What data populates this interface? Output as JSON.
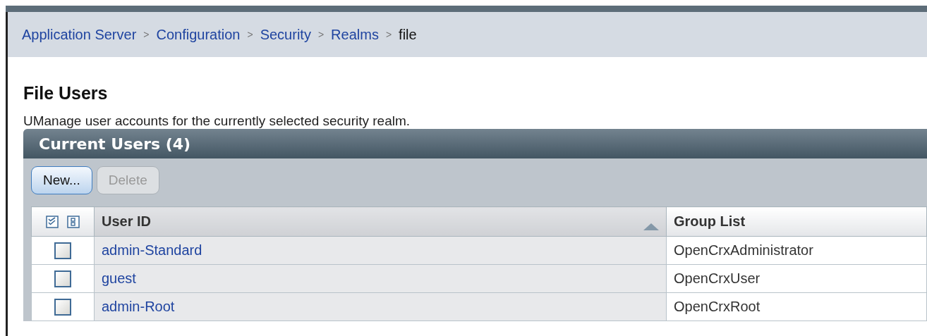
{
  "breadcrumb": [
    {
      "label": "Application Server",
      "link": true
    },
    {
      "label": "Configuration",
      "link": true
    },
    {
      "label": "Security",
      "link": true
    },
    {
      "label": "Realms",
      "link": true
    },
    {
      "label": "file",
      "link": false
    }
  ],
  "breadcrumb_separator": ">",
  "page_title": "File Users",
  "description": "UManage user accounts for the currently selected security realm.",
  "panel": {
    "title": "Current Users (4)"
  },
  "buttons": [
    {
      "label": "New...",
      "disabled": false
    },
    {
      "label": "Delete",
      "disabled": true
    }
  ],
  "table": {
    "columns": [
      {
        "label": "User ID",
        "sorted": true
      },
      {
        "label": "Group List",
        "sorted": false
      }
    ],
    "rows": [
      {
        "checked": false,
        "user_id": "admin-Standard",
        "groups": "OpenCrxAdministrator"
      },
      {
        "checked": false,
        "user_id": "guest",
        "groups": "OpenCrxUser"
      },
      {
        "checked": false,
        "user_id": "admin-Root",
        "groups": "OpenCrxRoot"
      }
    ]
  }
}
